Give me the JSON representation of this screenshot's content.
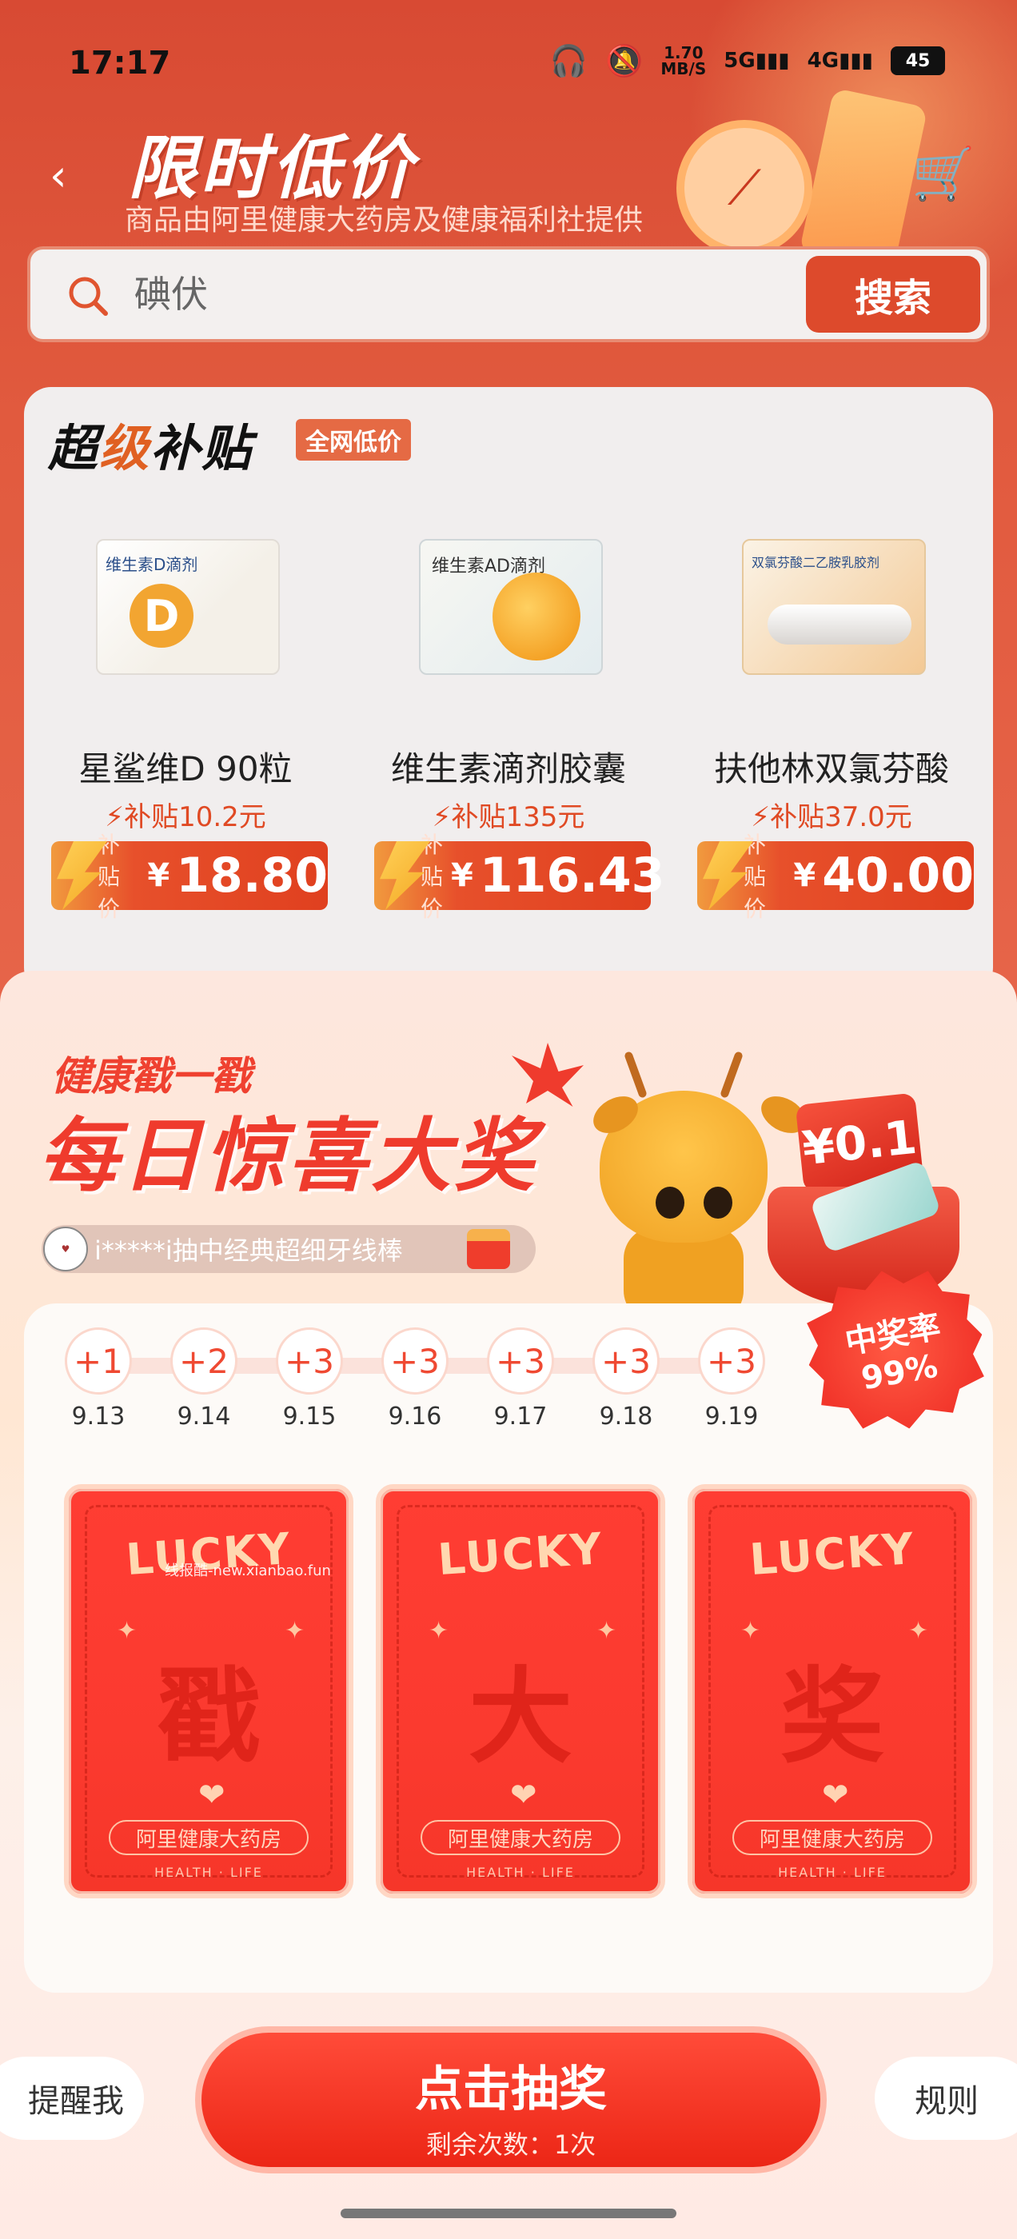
{
  "status_bar": {
    "time": "17:17",
    "speed_value": "1.70",
    "speed_unit": "MB/S",
    "net1": "5G",
    "net2": "4G",
    "battery": "45"
  },
  "header": {
    "title": "限时低价",
    "subtitle": "商品由阿里健康大药房及健康福利社提供"
  },
  "search": {
    "placeholder": "碘伏",
    "button": "搜索"
  },
  "subsidy": {
    "title_a": "超",
    "title_b": "级",
    "title_c": "补贴",
    "badge": "全网低价",
    "products": [
      {
        "name": "星鲨维D 90粒",
        "subsidy": "⚡补贴10.2元",
        "price_label": "补贴价",
        "currency": "¥",
        "price": "18.80"
      },
      {
        "name": "维生素滴剂胶囊",
        "subsidy": "⚡补贴135元",
        "price_label": "补贴价",
        "currency": "¥",
        "price": "116.43"
      },
      {
        "name": "扶他林双氯芬酸",
        "subsidy": "⚡补贴37.0元",
        "price_label": "补贴价",
        "currency": "¥",
        "price": "40.00"
      }
    ],
    "img_text_d": "维生素D滴剂",
    "img_text_ad": "维生素AD滴剂",
    "img_text_cream": "双氯芬酸二乙胺乳胶剂"
  },
  "sheet": {
    "subtitle": "健康戳一戳",
    "title": "每日惊喜大奖",
    "gift_amount": "¥0.1",
    "winner_text": "i*****i抽中经典超细牙线棒",
    "rate_label": "中奖率",
    "rate_value": "99%",
    "checkins": [
      {
        "bonus": "+1",
        "date": "9.13"
      },
      {
        "bonus": "+2",
        "date": "9.14"
      },
      {
        "bonus": "+3",
        "date": "9.15"
      },
      {
        "bonus": "+3",
        "date": "9.16"
      },
      {
        "bonus": "+3",
        "date": "9.17"
      },
      {
        "bonus": "+3",
        "date": "9.18"
      },
      {
        "bonus": "+3",
        "date": "9.19"
      }
    ],
    "cards": [
      {
        "word": "LUCKY",
        "char": "戳",
        "brand": "阿里健康大药房",
        "foot": "HEALTH · LIFE"
      },
      {
        "word": "LUCKY",
        "char": "大",
        "brand": "阿里健康大药房",
        "foot": "HEALTH · LIFE"
      },
      {
        "word": "LUCKY",
        "char": "奖",
        "brand": "阿里健康大药房",
        "foot": "HEALTH · LIFE"
      }
    ],
    "watermark": "线报酷-new.xianbao.fun"
  },
  "actions": {
    "remind": "提醒我",
    "draw": "点击抽奖",
    "remaining": "剩余次数：1次",
    "rules": "规则"
  }
}
